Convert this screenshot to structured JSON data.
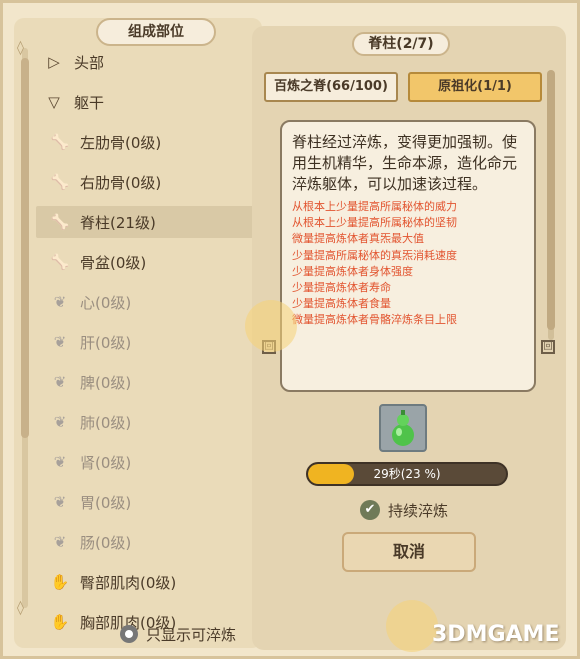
{
  "left_panel": {
    "title": "组成部位",
    "items": [
      {
        "label": "头部",
        "icon": "triangle-right-icon"
      },
      {
        "label": "躯干",
        "icon": "triangle-down-icon"
      },
      {
        "label": "左肋骨(0级)",
        "icon": "bone-icon"
      },
      {
        "label": "右肋骨(0级)",
        "icon": "bone-icon"
      },
      {
        "label": "脊柱(21级)",
        "icon": "bone-icon",
        "selected": true
      },
      {
        "label": "骨盆(0级)",
        "icon": "bone-icon"
      },
      {
        "label": "心(0级)",
        "icon": "organ-icon"
      },
      {
        "label": "肝(0级)",
        "icon": "organ-icon"
      },
      {
        "label": "脾(0级)",
        "icon": "organ-icon"
      },
      {
        "label": "肺(0级)",
        "icon": "organ-icon"
      },
      {
        "label": "肾(0级)",
        "icon": "organ-icon"
      },
      {
        "label": "胃(0级)",
        "icon": "organ-icon"
      },
      {
        "label": "肠(0级)",
        "icon": "organ-icon"
      },
      {
        "label": "臀部肌肉(0级)",
        "icon": "muscle-icon"
      },
      {
        "label": "胸部肌肉(0级)",
        "icon": "muscle-icon"
      }
    ],
    "filter_label": "只显示可淬炼"
  },
  "right_panel": {
    "title": "脊柱(2/7)",
    "tabs": [
      {
        "label": "百炼之脊(66/100)"
      },
      {
        "label": "原祖化(1/1)"
      }
    ],
    "description": "脊柱经过淬炼，变得更加强韧。使用生机精华，生命本源，造化命元淬炼躯体，可以加速该过程。",
    "effects": [
      "从根本上少量提高所属秘体的威力",
      "从根本上少量提高所属秘体的坚韧",
      "微量提高炼体者真炁最大值",
      "少量提高所属秘体的真炁消耗速度",
      "少量提高炼体者身体强度",
      "少量提高炼体者寿命",
      "少量提高炼体者食量",
      "微量提高炼体者骨骼淬炼条目上限"
    ],
    "progress": {
      "label": "29秒(23 %)",
      "percent": 23
    },
    "continuous_label": "持续淬炼",
    "cancel_label": "取消"
  },
  "watermark": "3DMGAME",
  "colors": {
    "background": "#f2e6cb",
    "accent_tab": "#f2c66a",
    "effect_text": "#e2542f",
    "progress_fill": "#f0b421"
  }
}
